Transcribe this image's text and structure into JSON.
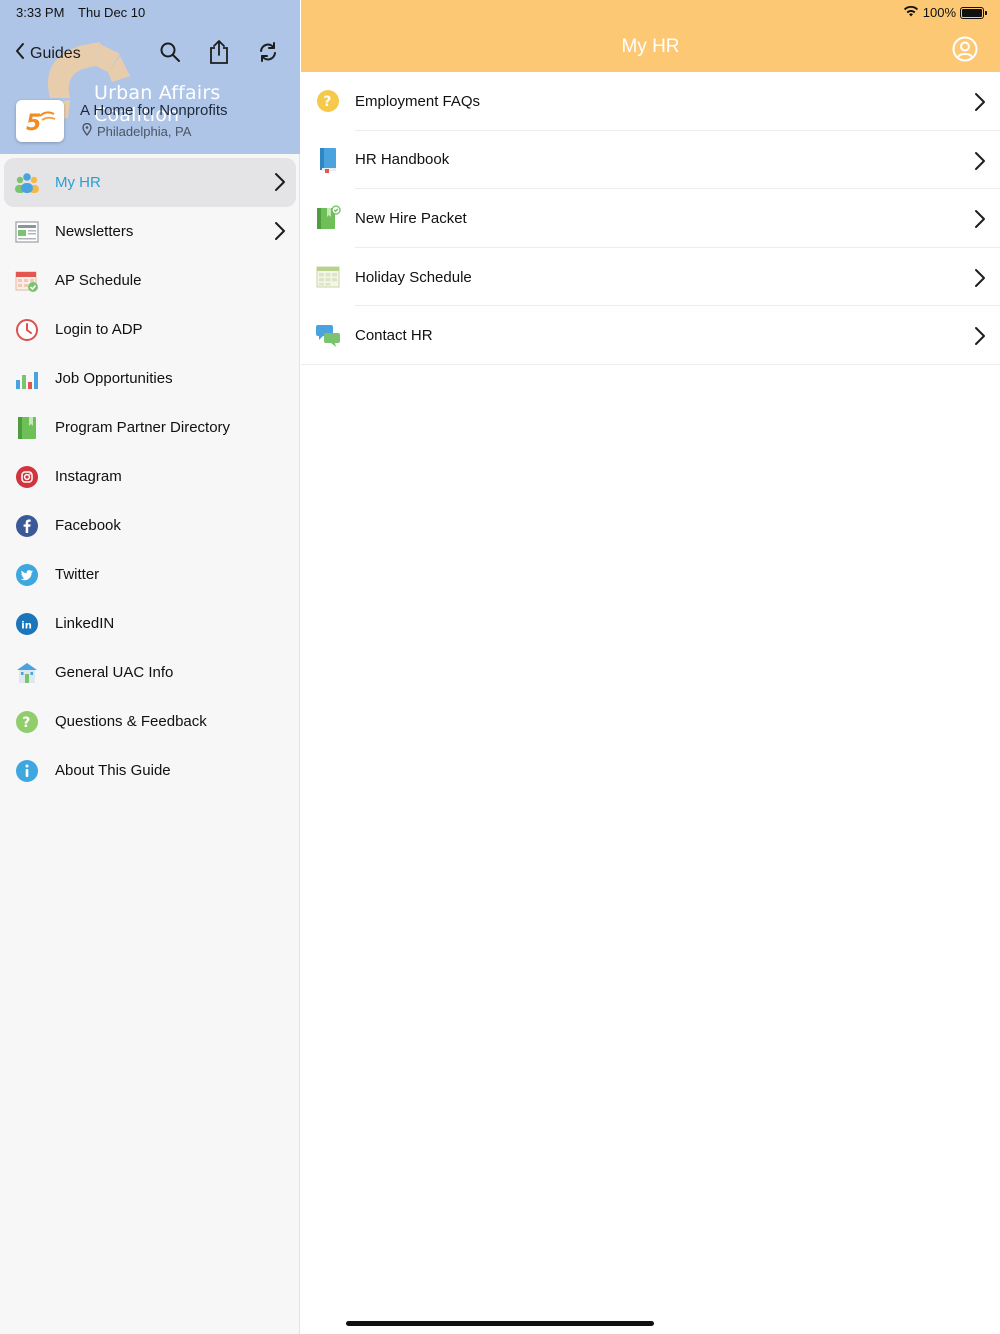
{
  "status_bar": {
    "time": "3:33 PM",
    "date": "Thu Dec 10",
    "battery": "100%"
  },
  "sidebar": {
    "back_label": "Guides",
    "org": {
      "name": "Urban Affairs Coalition",
      "tagline": "A Home for Nonprofits",
      "location": "Philadelphia, PA",
      "logo_text": "5"
    },
    "items": [
      {
        "label": "My HR",
        "icon": "people-icon",
        "active": true,
        "chevron": true
      },
      {
        "label": "Newsletters",
        "icon": "newspaper-icon",
        "active": false,
        "chevron": true
      },
      {
        "label": "AP Schedule",
        "icon": "calendar-check-icon",
        "active": false,
        "chevron": false
      },
      {
        "label": "Login to ADP",
        "icon": "clock-icon",
        "active": false,
        "chevron": false
      },
      {
        "label": "Job Opportunities",
        "icon": "bar-chart-icon",
        "active": false,
        "chevron": false
      },
      {
        "label": "Program Partner Directory",
        "icon": "book-icon",
        "active": false,
        "chevron": false
      },
      {
        "label": "Instagram",
        "icon": "instagram-icon",
        "active": false,
        "chevron": false
      },
      {
        "label": "Facebook",
        "icon": "facebook-icon",
        "active": false,
        "chevron": false
      },
      {
        "label": "Twitter",
        "icon": "twitter-icon",
        "active": false,
        "chevron": false
      },
      {
        "label": "LinkedIN",
        "icon": "linkedin-icon",
        "active": false,
        "chevron": false
      },
      {
        "label": "General UAC Info",
        "icon": "building-icon",
        "active": false,
        "chevron": false
      },
      {
        "label": "Questions & Feedback",
        "icon": "question-green-icon",
        "active": false,
        "chevron": false
      },
      {
        "label": "About This Guide",
        "icon": "info-icon",
        "active": false,
        "chevron": false
      }
    ]
  },
  "main": {
    "title": "My HR",
    "items": [
      {
        "label": "Employment FAQs",
        "icon": "question-yellow-icon"
      },
      {
        "label": "HR Handbook",
        "icon": "handbook-icon"
      },
      {
        "label": "New Hire Packet",
        "icon": "packet-icon"
      },
      {
        "label": "Holiday Schedule",
        "icon": "calendar-grid-icon"
      },
      {
        "label": "Contact HR",
        "icon": "chat-bubbles-icon"
      }
    ]
  },
  "colors": {
    "sidebar_header": "#aec5e8",
    "main_header": "#fcc874",
    "active_text": "#2a9fd6",
    "active_bg": "#e4e4e6"
  }
}
